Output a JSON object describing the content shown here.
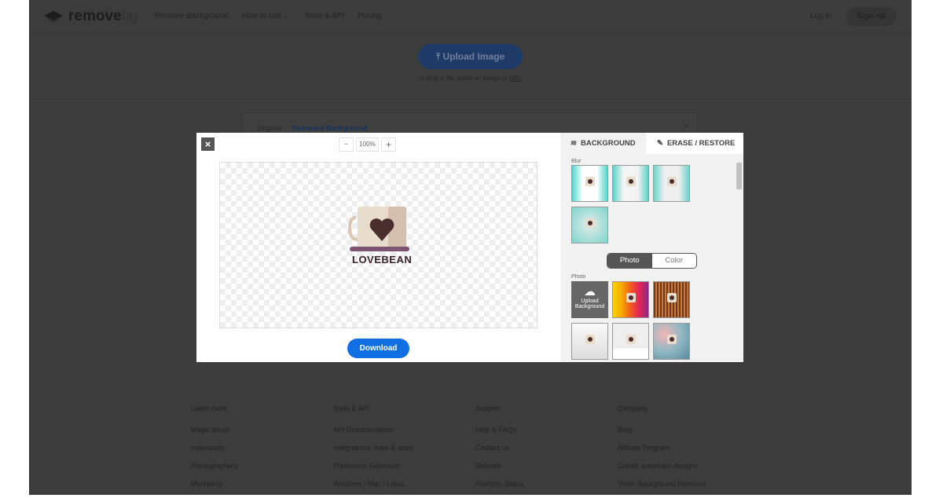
{
  "header": {
    "logo": {
      "word": "remove",
      "suffix": "bg"
    },
    "nav": [
      "Remove Background",
      "How to use",
      "Tools & API",
      "Pricing"
    ],
    "login": "Log in",
    "signup": "Sign up"
  },
  "hero": {
    "upload_label": "Upload Image",
    "drop_text": "or drop a file, paste an image or ",
    "url_link": "URL"
  },
  "result_card": {
    "tabs": [
      "Original",
      "Removed Background"
    ],
    "close": "×"
  },
  "editor": {
    "close": "×",
    "zoom_out": "−",
    "zoom_level": "100%",
    "zoom_in": "+",
    "image_text": "LOVEBEAN",
    "download": "Download",
    "panel": {
      "tabs": [
        "BACKGROUND",
        "ERASE / RESTORE"
      ],
      "blur_label": "Blur",
      "toggle": [
        "Photo",
        "Color"
      ],
      "photo_label": "Photo",
      "upload_bg": [
        "Upload",
        "Background"
      ]
    }
  },
  "footer": [
    {
      "title": "Learn more",
      "links": [
        "Magic Brush",
        "Individuals",
        "Photographers",
        "Marketing"
      ]
    },
    {
      "title": "Tools & API",
      "links": [
        "API Documentation",
        "Integrations, tools & apps",
        "Photoshop Extension",
        "Windows / Mac / Linux"
      ]
    },
    {
      "title": "Support",
      "links": [
        "Help & FAQs",
        "Contact us",
        "Refunds",
        "Platform Status"
      ]
    },
    {
      "title": "Company",
      "links": [
        "Blog",
        "Affiliate Program",
        "Create automatic designs",
        "Video Background Removal"
      ]
    }
  ],
  "colors": {
    "download": "#0f6fe3",
    "overlay": "#3c3c3c",
    "upload": "#1e3a66"
  }
}
